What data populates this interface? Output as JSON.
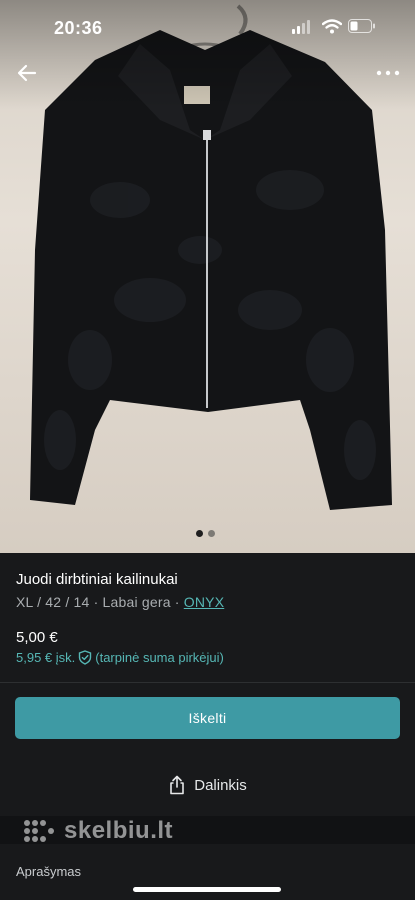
{
  "status_bar": {
    "time": "20:36"
  },
  "gallery": {
    "image_count": 2,
    "active_index": 0
  },
  "listing": {
    "title": "Juodi dirbtiniai kailinukai",
    "details": "XL / 42 / 14 · Labai gera · ",
    "brand": "ONYX",
    "price": "5,00 €",
    "price_incl": "5,95 € įsk.",
    "buyer_protection": "(tarpinė suma pirkėjui)"
  },
  "actions": {
    "primary_label": "Iškelti",
    "share_label": "Dalinkis"
  },
  "watermark": {
    "text": "skelbiu.lt"
  },
  "section": {
    "description_label": "Aprašymas"
  },
  "colors": {
    "accent": "#3e9aa4",
    "link": "#56b7b5",
    "background": "#18191b"
  },
  "icons": [
    "back-arrow-icon",
    "more-dots-icon",
    "signal-icon",
    "wifi-icon",
    "battery-icon",
    "shield-check-icon",
    "share-icon"
  ]
}
